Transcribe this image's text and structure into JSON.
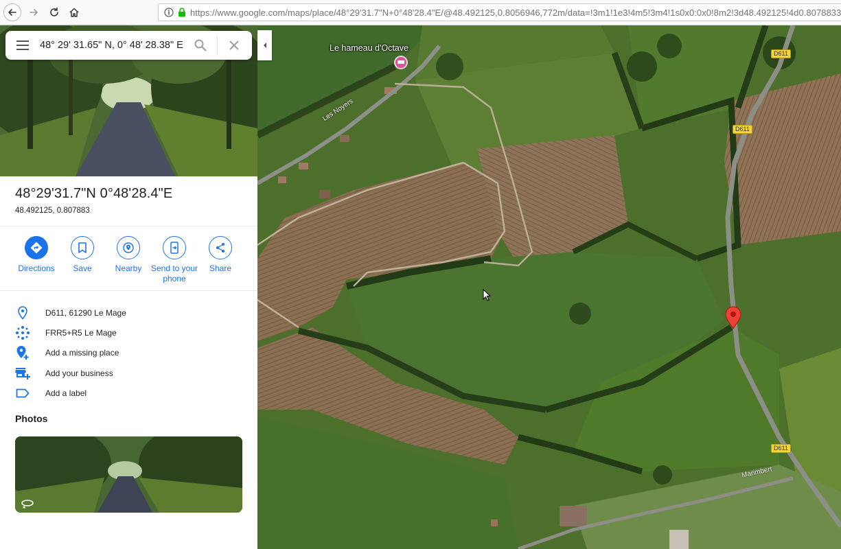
{
  "browser": {
    "url": "https://www.google.com/maps/place/48°29'31.7\"N+0°48'28.4\"E/@48.492125,0.8056946,772m/data=!3m1!1e3!4m5!3m4!1s0x0:0x0!8m2!3d48.492125!4d0.8078833",
    "icons": [
      "back-arrow-icon",
      "forward-arrow-icon",
      "reload-icon",
      "home-icon",
      "info-icon",
      "lock-icon"
    ]
  },
  "search": {
    "value": "48° 29' 31.65\" N, 0° 48' 28.38\" E",
    "icons": [
      "hamburger-menu-icon",
      "search-icon",
      "close-icon"
    ]
  },
  "place": {
    "title": "48°29'31.7\"N 0°48'28.4\"E",
    "decimal": "48.492125, 0.807883"
  },
  "actions": [
    {
      "label": "Directions",
      "icon": "directions-icon"
    },
    {
      "label": "Save",
      "icon": "bookmark-icon"
    },
    {
      "label": "Nearby",
      "icon": "nearby-icon"
    },
    {
      "label": "Send to your phone",
      "icon": "send-to-phone-icon"
    },
    {
      "label": "Share",
      "icon": "share-icon"
    }
  ],
  "info": [
    {
      "text": "D611, 61290 Le Mage",
      "icon": "location-pin-icon"
    },
    {
      "text": "FRR5+R5 Le Mage",
      "icon": "plus-code-icon"
    },
    {
      "text": "Add a missing place",
      "icon": "add-place-icon"
    },
    {
      "text": "Add your business",
      "icon": "add-business-icon"
    },
    {
      "text": "Add a label",
      "icon": "label-icon"
    }
  ],
  "photos": {
    "heading": "Photos"
  },
  "map": {
    "poi_label": "Le hameau d'Octave",
    "road_les_noyers": "Les Noyers",
    "road_marimbert": "Marimbert",
    "shield_d611": "D611",
    "colors": {
      "accent": "#1a73e8",
      "marker": "#ea4335",
      "poi": "#e0539b"
    }
  }
}
